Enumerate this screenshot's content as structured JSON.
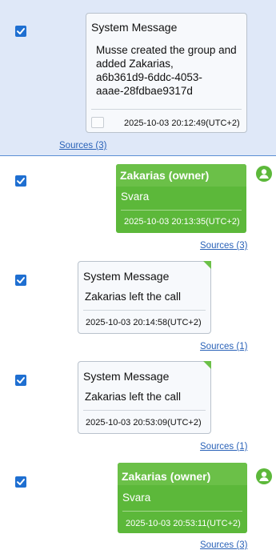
{
  "messages": [
    {
      "title": "System Message",
      "line1": "Musse created the group and",
      "line2": "added Zakarias,",
      "line3": "a6b361d9-6ddc-4053-",
      "line4": "aaae-28fdbae9317d",
      "timestamp": "2025-10-03 20:12:49(UTC+2)",
      "sources": "Sources (3)"
    },
    {
      "sender": "Zakarias (owner)",
      "text": "Svara",
      "timestamp": "2025-10-03 20:13:35(UTC+2)",
      "sources": "Sources (3)"
    },
    {
      "title": "System Message",
      "text": "Zakarias left the call",
      "timestamp": "2025-10-03 20:14:58(UTC+2)",
      "sources": "Sources (1)"
    },
    {
      "title": "System Message",
      "text": "Zakarias left the call",
      "timestamp": "2025-10-03 20:53:09(UTC+2)",
      "sources": "Sources (1)"
    },
    {
      "sender": "Zakarias (owner)",
      "text": "Svara",
      "timestamp": "2025-10-03 20:53:11(UTC+2)",
      "sources": "Sources (3)"
    }
  ],
  "colors": {
    "outgoing_bubble": "#5cb83a",
    "outgoing_header": "#6bc048",
    "checkbox": "#1f6fd1",
    "selected_row": "#dfe8f8",
    "link": "#2a62b8"
  },
  "icons": {
    "checkbox": "checkmark-icon",
    "avatar": "user-avatar-icon",
    "attachment": "attachment-placeholder-icon"
  }
}
